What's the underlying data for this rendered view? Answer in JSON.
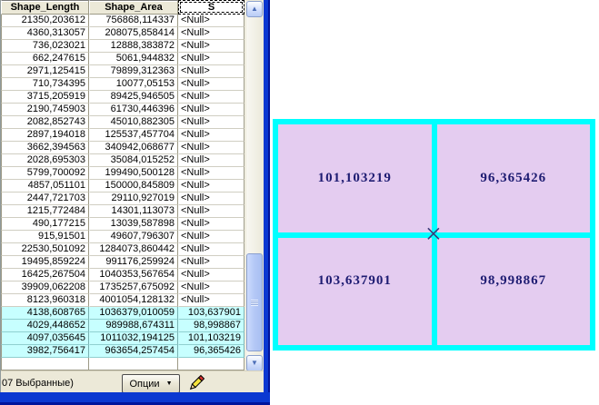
{
  "table": {
    "columns": [
      "Shape_Length",
      "Shape_Area",
      "S"
    ],
    "null_display": "<Null>",
    "rows": [
      {
        "shape_length": "21350,203612",
        "shape_area": "756868,114337",
        "s": "<Null>",
        "selected": false
      },
      {
        "shape_length": "4360,313057",
        "shape_area": "208075,858414",
        "s": "<Null>",
        "selected": false
      },
      {
        "shape_length": "736,023021",
        "shape_area": "12888,383872",
        "s": "<Null>",
        "selected": false
      },
      {
        "shape_length": "662,247615",
        "shape_area": "5061,944832",
        "s": "<Null>",
        "selected": false
      },
      {
        "shape_length": "2971,125415",
        "shape_area": "79899,312363",
        "s": "<Null>",
        "selected": false
      },
      {
        "shape_length": "710,734395",
        "shape_area": "10077,05153",
        "s": "<Null>",
        "selected": false
      },
      {
        "shape_length": "3715,205919",
        "shape_area": "89425,946505",
        "s": "<Null>",
        "selected": false
      },
      {
        "shape_length": "2190,745903",
        "shape_area": "61730,446396",
        "s": "<Null>",
        "selected": false
      },
      {
        "shape_length": "2082,852743",
        "shape_area": "45010,882305",
        "s": "<Null>",
        "selected": false
      },
      {
        "shape_length": "2897,194018",
        "shape_area": "125537,457704",
        "s": "<Null>",
        "selected": false
      },
      {
        "shape_length": "3662,394563",
        "shape_area": "340942,068677",
        "s": "<Null>",
        "selected": false
      },
      {
        "shape_length": "2028,695303",
        "shape_area": "35084,015252",
        "s": "<Null>",
        "selected": false
      },
      {
        "shape_length": "5799,700092",
        "shape_area": "199490,500128",
        "s": "<Null>",
        "selected": false
      },
      {
        "shape_length": "4857,051101",
        "shape_area": "150000,845809",
        "s": "<Null>",
        "selected": false
      },
      {
        "shape_length": "2447,721703",
        "shape_area": "29110,927019",
        "s": "<Null>",
        "selected": false
      },
      {
        "shape_length": "1215,772484",
        "shape_area": "14301,113073",
        "s": "<Null>",
        "selected": false
      },
      {
        "shape_length": "490,177215",
        "shape_area": "13039,587898",
        "s": "<Null>",
        "selected": false
      },
      {
        "shape_length": "915,91501",
        "shape_area": "49607,796307",
        "s": "<Null>",
        "selected": false
      },
      {
        "shape_length": "22530,501092",
        "shape_area": "1284073,860442",
        "s": "<Null>",
        "selected": false
      },
      {
        "shape_length": "19495,859224",
        "shape_area": "991176,259924",
        "s": "<Null>",
        "selected": false
      },
      {
        "shape_length": "16425,267504",
        "shape_area": "1040353,567654",
        "s": "<Null>",
        "selected": false
      },
      {
        "shape_length": "39909,062208",
        "shape_area": "1735257,675092",
        "s": "<Null>",
        "selected": false
      },
      {
        "shape_length": "8123,960318",
        "shape_area": "4001054,128132",
        "s": "<Null>",
        "selected": false
      },
      {
        "shape_length": "4138,608765",
        "shape_area": "1036379,010059",
        "s": "103,637901",
        "selected": true
      },
      {
        "shape_length": "4029,448652",
        "shape_area": "989988,674311",
        "s": "98,998867",
        "selected": true
      },
      {
        "shape_length": "4097,035645",
        "shape_area": "1011032,194125",
        "s": "101,103219",
        "selected": true
      },
      {
        "shape_length": "3982,756417",
        "shape_area": "963654,257454",
        "s": "96,365426",
        "selected": true
      }
    ]
  },
  "status_bar": {
    "selection_text": "07 Выбранные)",
    "options_button_label": "Опции"
  },
  "icons": {
    "scroll_up_icon": "▲",
    "scroll_down_icon": "▼",
    "dropdown_icon": "▼"
  },
  "map": {
    "quads": [
      {
        "position": "top-left",
        "label": "101,103219"
      },
      {
        "position": "top-right",
        "label": "96,365426"
      },
      {
        "position": "bottom-left",
        "label": "103,637901"
      },
      {
        "position": "bottom-right",
        "label": "98,998867"
      }
    ]
  },
  "colors": {
    "selection_row_fill": "#C7FFFF",
    "map_outline": "#00FFFF",
    "map_parcel_fill": "#E4CCF0",
    "map_label_color": "#1E1C72",
    "window_border_blue": "#0B38D1",
    "chrome_beige": "#ECE9D8"
  }
}
